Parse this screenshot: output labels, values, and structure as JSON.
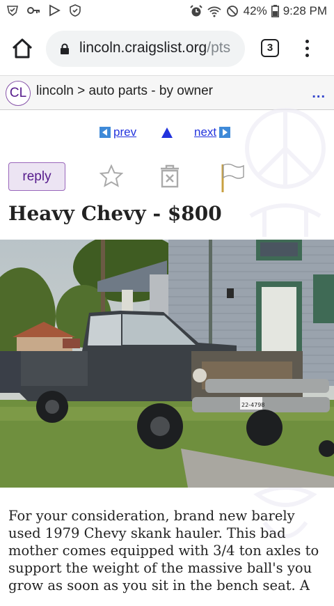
{
  "status_bar": {
    "battery": "42%",
    "time": "9:28 PM"
  },
  "browser": {
    "url_host": "lincoln.craigslist.org",
    "url_path": "/pts",
    "tab_count": "3"
  },
  "breadcrumb": {
    "logo": "CL",
    "path": "lincoln > auto parts - by owner",
    "more": "..."
  },
  "nav": {
    "prev": "prev",
    "next": "next"
  },
  "actions": {
    "reply": "reply"
  },
  "posting": {
    "title": "Heavy Chevy - $800",
    "body": "For your consideration, brand new barely used 1979 Chevy skank hauler. This bad mother comes equipped with 3/4 ton axles to support the weight of the massive ball's you grow as soon as you sit in the bench seat. A",
    "plate": "22-4798"
  },
  "colors": {
    "link": "#2233dd",
    "cl_purple": "#551a8b",
    "nav_box": "#3f8ad8"
  }
}
